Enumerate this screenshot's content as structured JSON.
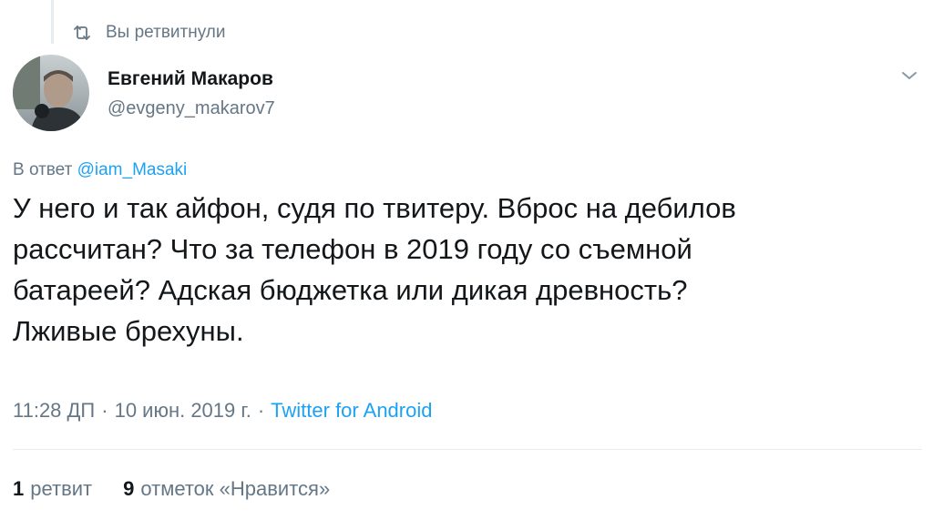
{
  "retweet_header": {
    "label": "Вы ретвитнули",
    "icon": "retweet-icon"
  },
  "author": {
    "name": "Евгений Макаров",
    "handle": "@evgeny_makarov7",
    "avatar": "avatar-photo"
  },
  "reply": {
    "prefix": "В ответ ",
    "mention": "@iam_Masaki"
  },
  "tweet": {
    "text": "У него и так айфон, судя по твитеру. Вброс на дебилов\nрассчитан? Что за телефон в 2019 году со съемной\nбатареей? Адская бюджетка или дикая древность?\nЛживые брехуны."
  },
  "meta": {
    "time": "11:28 ДП",
    "separator": "·",
    "date": "10 июн. 2019 г.",
    "separator2": "·",
    "source": "Twitter for Android"
  },
  "stats": {
    "retweets_count": "1",
    "retweets_label": "ретвит",
    "likes_count": "9",
    "likes_label": "отметок «Нравится»"
  },
  "colors": {
    "link": "#1da1f2",
    "secondary": "#657786",
    "text": "#14171a",
    "divider": "#e6ecf0"
  }
}
